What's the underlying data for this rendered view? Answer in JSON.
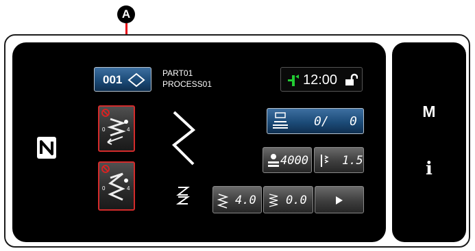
{
  "callout": {
    "label": "A"
  },
  "program": {
    "number": "001"
  },
  "pattern_info": {
    "name": "PART01",
    "process": "PROCESS01"
  },
  "status": {
    "time": "12:00"
  },
  "counter": {
    "value": "0/",
    "total": "0"
  },
  "stitch_count": {
    "value": "4000"
  },
  "needle_setting": {
    "value": "1.5"
  },
  "stitch_length": {
    "value": "4.0"
  },
  "condensation": {
    "value": "0.0"
  },
  "side_keys": {
    "mode": "M",
    "info": "i"
  },
  "colors": {
    "accent_red": "#e60012",
    "nfc_bg": "#ffffff",
    "button_blue": "#1c4b78",
    "status_green": "#22cc33"
  },
  "icons": [
    "nfc-icon",
    "lock-open-icon",
    "thread-icon",
    "counter-icon",
    "stitch-count-icon",
    "needle-icon",
    "play-icon",
    "reverse-stitch-icon",
    "zigzag-icon",
    "condense-icon"
  ]
}
